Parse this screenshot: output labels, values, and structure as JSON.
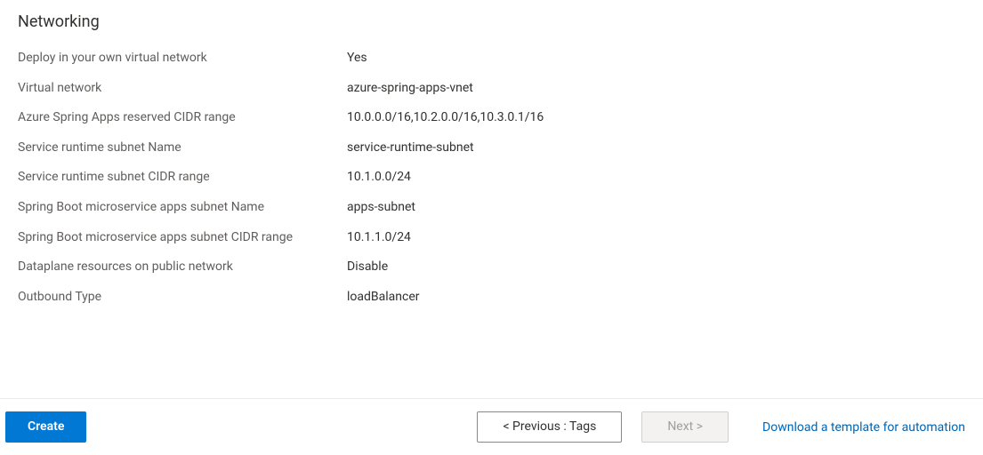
{
  "section": {
    "title": "Networking",
    "rows": [
      {
        "label": "Deploy in your own virtual network",
        "value": "Yes"
      },
      {
        "label": "Virtual network",
        "value": "azure-spring-apps-vnet"
      },
      {
        "label": "Azure Spring Apps reserved CIDR range",
        "value": "10.0.0.0/16,10.2.0.0/16,10.3.0.1/16"
      },
      {
        "label": "Service runtime subnet Name",
        "value": "service-runtime-subnet"
      },
      {
        "label": "Service runtime subnet CIDR range",
        "value": "10.1.0.0/24"
      },
      {
        "label": "Spring Boot microservice apps subnet Name",
        "value": "apps-subnet"
      },
      {
        "label": "Spring Boot microservice apps subnet CIDR range",
        "value": "10.1.1.0/24"
      },
      {
        "label": "Dataplane resources on public network",
        "value": "Disable"
      },
      {
        "label": "Outbound Type",
        "value": "loadBalancer"
      }
    ]
  },
  "footer": {
    "create_label": "Create",
    "previous_label": "<  Previous : Tags",
    "next_label": "Next  >",
    "download_link": "Download a template for automation"
  }
}
